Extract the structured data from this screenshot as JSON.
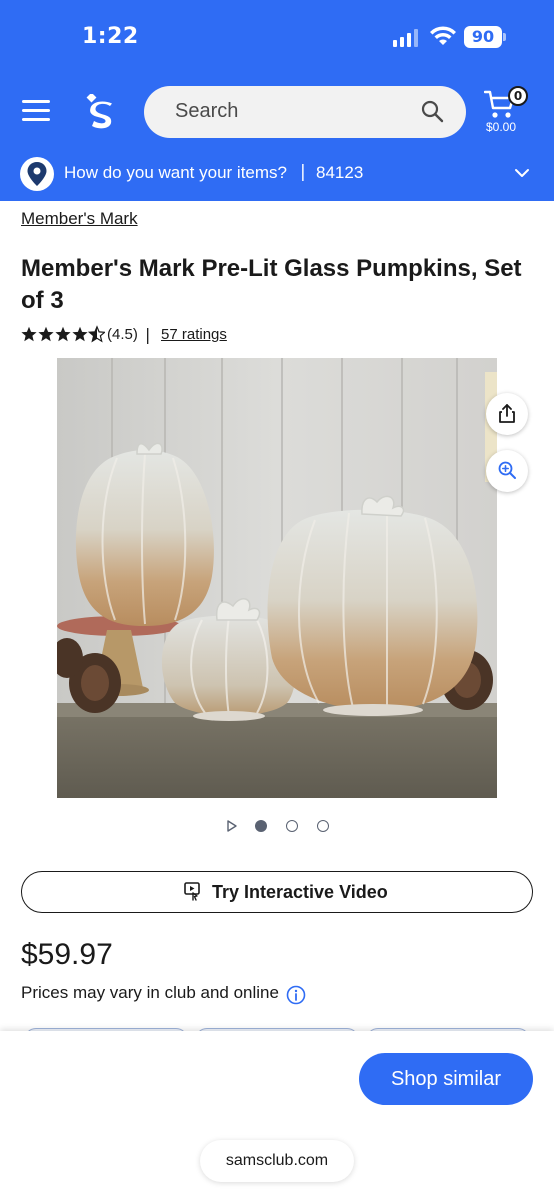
{
  "status_bar": {
    "time": "1:22",
    "battery": "90"
  },
  "header": {
    "search_placeholder": "Search",
    "cart_count": "0",
    "cart_total": "$0.00",
    "icons": [
      "menu-icon",
      "sams-logo-icon",
      "search-icon",
      "cart-icon"
    ]
  },
  "delivery": {
    "prompt": "How do you want your items?",
    "separator": "|",
    "zip": "84123"
  },
  "product": {
    "breadcrumb": "Member's Mark",
    "title": "Member's Mark Pre-Lit Glass Pumpkins, Set of 3",
    "rating": "(4.5)",
    "rating_separator": "|",
    "ratings_count": "57 ratings",
    "rating_value": 4.5,
    "price": "$59.97",
    "price_note": "Prices may vary in club and online",
    "carousel": {
      "slide_count": 3,
      "active_index": 0
    }
  },
  "actions": {
    "video_label": "Try Interactive Video",
    "shop_similar": "Shop similar"
  },
  "browser": {
    "url": "samsclub.com"
  },
  "colors": {
    "brand_blue": "#2f6cf4",
    "text": "#1a1a1a"
  }
}
